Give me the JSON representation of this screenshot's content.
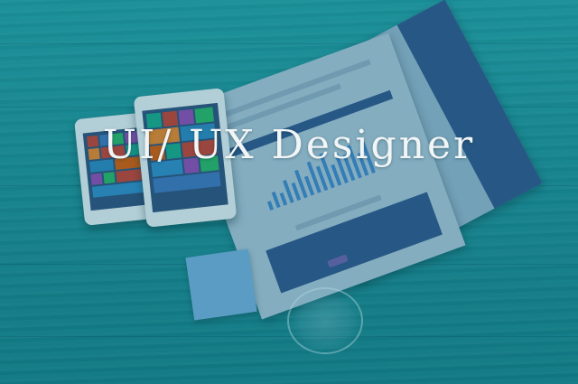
{
  "banner": {
    "title": "UI/ UX Designer"
  },
  "colors": {
    "background": "#1b8c94",
    "title_text": "#f2f5f6"
  }
}
